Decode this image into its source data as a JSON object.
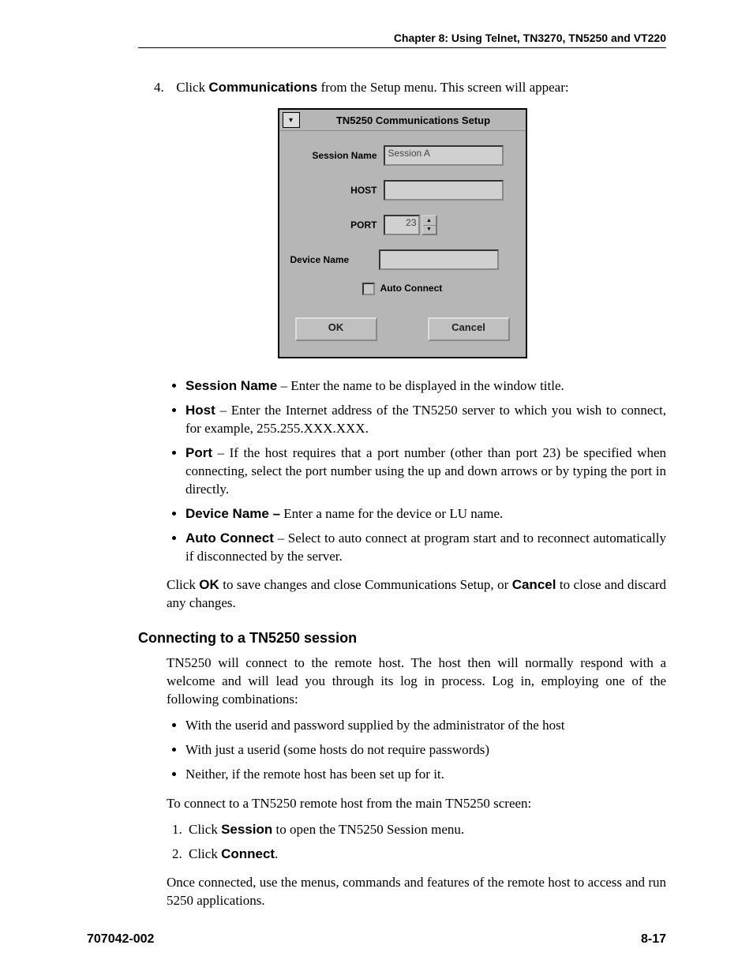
{
  "header": "Chapter 8: Using Telnet, TN3270, TN5250 and VT220",
  "step4": {
    "num": "4.",
    "pre": "Click ",
    "bold": "Communications",
    "post": " from the Setup menu. This screen will appear:"
  },
  "dialog": {
    "title": "TN5250 Communications Setup",
    "session_label": "Session Name",
    "session_value": "Session A",
    "host_label": "HOST",
    "host_value": "",
    "port_label": "PORT",
    "port_value": "23",
    "device_label": "Device Name",
    "device_value": "",
    "auto_label": "Auto Connect",
    "ok": "OK",
    "cancel": "Cancel"
  },
  "bullets1": [
    {
      "bold": "Session Name",
      "text": " – Enter the name to be displayed in the window title."
    },
    {
      "bold": "Host",
      "text": " – Enter the Internet address of the TN5250 server to which you wish to connect, for example, 255.255.XXX.XXX."
    },
    {
      "bold": "Port",
      "text": " – If the host requires that a port number (other than port 23) be specified when connecting, select the port number using the up and down arrows or by typing the port in directly."
    },
    {
      "bold": "Device Name –",
      "text": " Enter a name for the device or LU name."
    },
    {
      "bold": "Auto Connect",
      "text": " – Select to auto connect at program start and to reconnect automatically if disconnected by the server."
    }
  ],
  "okcancel": {
    "pre": "Click ",
    "b1": "OK",
    "mid": " to save changes and close Communications Setup, or ",
    "b2": "Cancel",
    "post": " to close and discard any changes."
  },
  "section_heading": "Connecting to a TN5250 session",
  "para1": "TN5250 will connect to the remote host. The host then will normally respond with a welcome and will lead you through its log in process. Log in, employing one of the following combinations:",
  "bullets2": [
    "With the userid and password supplied by the administrator of the host",
    "With just a userid (some hosts do not require passwords)",
    "Neither, if the remote host has been set up for it."
  ],
  "para2": "To connect to a TN5250 remote host from the main TN5250 screen:",
  "steps": [
    {
      "pre": "Click ",
      "bold": "Session",
      "post": " to open the TN5250 Session menu."
    },
    {
      "pre": "Click ",
      "bold": "Connect",
      "post": "."
    }
  ],
  "para3": "Once connected, use the menus, commands and features of the remote host to access and run 5250 applications.",
  "footer_left": "707042-002",
  "footer_right": "8-17"
}
